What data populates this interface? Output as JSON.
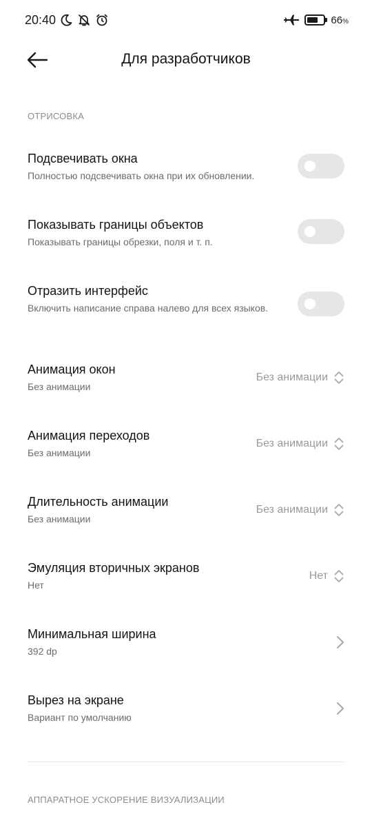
{
  "status_bar": {
    "time": "20:40",
    "battery_percent": "66",
    "battery_suffix": "%",
    "icons_left": [
      "moon-icon",
      "bell-off-icon",
      "alarm-icon"
    ],
    "icons_right": [
      "airplane-icon",
      "battery-icon"
    ]
  },
  "header": {
    "title": "Для разработчиков",
    "back_icon": "back-arrow-icon"
  },
  "sections": {
    "drawing_title": "ОТРИСОВКА",
    "hw_accel_title": "АППАРАТНОЕ УСКОРЕНИЕ ВИЗУАЛИЗАЦИИ"
  },
  "items": [
    {
      "title": "Подсвечивать окна",
      "subtitle": "Полностью подсвечивать окна при их обновлении.",
      "control": "toggle",
      "on": false
    },
    {
      "title": "Показывать границы объектов",
      "subtitle": "Показывать границы обрезки, поля и т. п.",
      "control": "toggle",
      "on": false
    },
    {
      "title": "Отразить интерфейс",
      "subtitle": "Включить написание справа налево для всех языков.",
      "control": "toggle",
      "on": false
    },
    {
      "title": "Анимация окон",
      "subtitle": "Без анимации",
      "control": "select",
      "value": "Без анимации"
    },
    {
      "title": "Анимация переходов",
      "subtitle": "Без анимации",
      "control": "select",
      "value": "Без анимации"
    },
    {
      "title": "Длительность анимации",
      "subtitle": "Без анимации",
      "control": "select",
      "value": "Без анимации"
    },
    {
      "title": "Эмуляция вторичных экранов",
      "subtitle": "Нет",
      "control": "select",
      "value": "Нет"
    },
    {
      "title": "Минимальная ширина",
      "subtitle": "392 dp",
      "control": "chevron"
    },
    {
      "title": "Вырез на экране",
      "subtitle": "Вариант по умолчанию",
      "control": "chevron"
    }
  ]
}
